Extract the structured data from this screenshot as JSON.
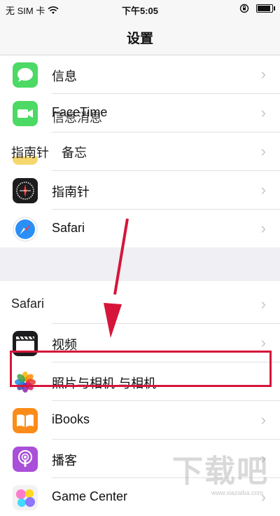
{
  "status": {
    "carrier": "无 SIM 卡",
    "time": "下午5:05",
    "battery_level": 0.82
  },
  "nav": {
    "title": "设置"
  },
  "rows": [
    {
      "label": "信息",
      "icon": "messages-icon"
    },
    {
      "label": "FaceTime",
      "ghost": "信息消息",
      "icon": "facetime-icon"
    },
    {
      "ghost_left": "指南针",
      "ghost_right": "备忘",
      "icon": "notes-icon"
    },
    {
      "label": "指南针",
      "icon": "compass-icon"
    },
    {
      "label": "Safari",
      "icon": "safari-icon"
    },
    {
      "ghost_left": "Safari",
      "icon": "none"
    },
    {
      "label": "视频",
      "icon": "videos-icon"
    },
    {
      "label": "照片与相机 与相机",
      "icon": "photos-icon"
    },
    {
      "label": "iBooks",
      "icon": "ibooks-icon"
    },
    {
      "label": "播客",
      "icon": "podcasts-icon"
    },
    {
      "label": "Game Center",
      "icon": "game-center-icon"
    }
  ],
  "watermark": {
    "logo": "下载吧",
    "url": "www.xiazaiba.com"
  },
  "colors": {
    "highlight": "#d6153a",
    "chevron": "#c7c7cc"
  }
}
